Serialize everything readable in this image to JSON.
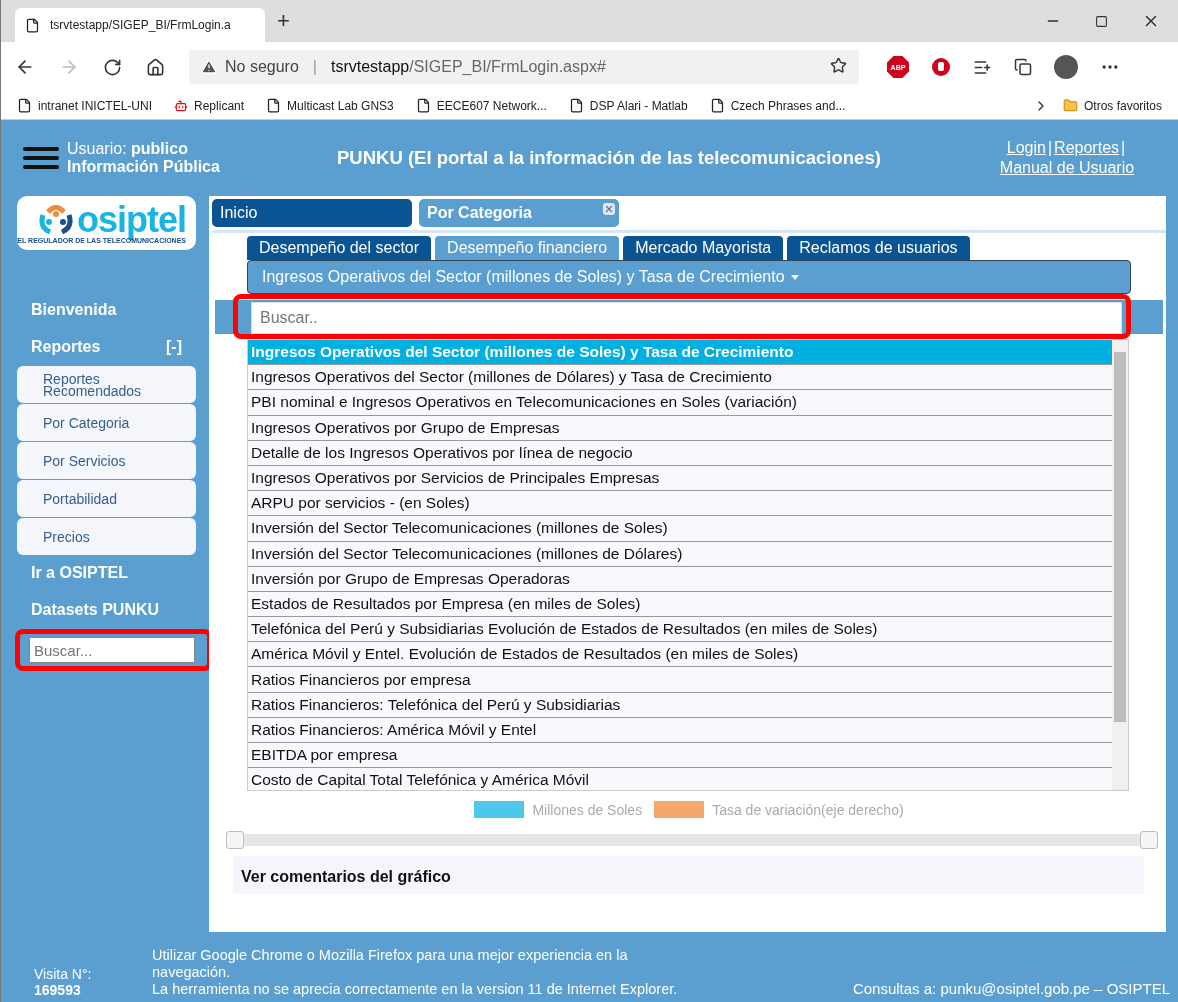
{
  "browser": {
    "tab_title": "tsrvtestapp/SIGEP_BI/FrmLogin.a",
    "new_tab": "+",
    "security": "No seguro",
    "url_separator": "|",
    "url_host": "tsrvtestapp",
    "url_path": "/SIGEP_BI/FrmLogin.aspx#",
    "extension_label": "ABP",
    "bookmarks": [
      {
        "label": "intranet INICTEL-UNI",
        "kind": "page"
      },
      {
        "label": "Replicant",
        "kind": "robot"
      },
      {
        "label": "Multicast Lab   GNS3",
        "kind": "page"
      },
      {
        "label": "EECE607  Network...",
        "kind": "page"
      },
      {
        "label": "DSP Alari - Matlab",
        "kind": "page"
      },
      {
        "label": "Czech Phrases and...",
        "kind": "page"
      }
    ],
    "other_bookmarks": "Otros favoritos"
  },
  "header": {
    "user_label": "Usuario:",
    "user_name": "publico",
    "profile": "Información Pública",
    "title": "PUNKU (El portal a la información de las telecomunicaciones)",
    "links": [
      "Login",
      "Reportes",
      "Manual de Usuario"
    ],
    "separator": "|"
  },
  "sidebar": {
    "logo": "osiptel",
    "tagline": "EL REGULADOR DE LAS TELECOMUNICACIONES",
    "items": [
      {
        "label": "Bienvenida"
      },
      {
        "label": "Reportes",
        "toggle": "[-]",
        "expanded": true,
        "children": [
          {
            "label": "Reportes Recomendados"
          },
          {
            "label": "Por Categoria"
          },
          {
            "label": "Por Servicios"
          },
          {
            "label": "Portabilidad"
          },
          {
            "label": "Precios"
          }
        ]
      },
      {
        "label": "Ir a OSIPTEL"
      },
      {
        "label": "Datasets PUNKU"
      }
    ],
    "search_placeholder": "Buscar..."
  },
  "tabs": [
    {
      "label": "Inicio",
      "selected": false
    },
    {
      "label": "Por Categoria",
      "selected": true,
      "closable": true
    }
  ],
  "subtabs": [
    {
      "label": "Desempeño del sector",
      "selected": false
    },
    {
      "label": "Desempeño financiero",
      "selected": true
    },
    {
      "label": "Mercado Mayorista",
      "selected": false
    },
    {
      "label": "Reclamos de usuarios",
      "selected": false
    }
  ],
  "report_dropdown": {
    "label": "Ingresos Operativos del Sector (millones de Soles) y Tasa de Crecimiento",
    "expanded": true,
    "search_placeholder": "Buscar..",
    "options": [
      {
        "label": "Ingresos Operativos del Sector (millones de Soles) y Tasa de Crecimiento",
        "selected": true
      },
      {
        "label": "Ingresos Operativos del Sector (millones de Dólares) y Tasa de Crecimiento",
        "selected": false
      },
      {
        "label": "PBI nominal e Ingresos Operativos en Telecomunicaciones en Soles (variación)",
        "selected": false
      },
      {
        "label": "Ingresos Operativos por Grupo de Empresas",
        "selected": false
      },
      {
        "label": "Detalle de los Ingresos Operativos por línea de negocio",
        "selected": false
      },
      {
        "label": "Ingresos Operativos por Servicios de Principales Empresas",
        "selected": false
      },
      {
        "label": "ARPU por servicios - (en Soles)",
        "selected": false
      },
      {
        "label": "Inversión del Sector Telecomunicaciones (millones de Soles)",
        "selected": false
      },
      {
        "label": "Inversión del Sector Telecomunicaciones (millones de Dólares)",
        "selected": false
      },
      {
        "label": "Inversión por Grupo de Empresas Operadoras",
        "selected": false
      },
      {
        "label": "Estados de Resultados por Empresa (en miles de Soles)",
        "selected": false
      },
      {
        "label": "Telefónica del Perú y Subsidiarias Evolución de Estados de Resultados (en miles de Soles)",
        "selected": false
      },
      {
        "label": "América Móvil y Entel. Evolución de Estados de Resultados (en miles de Soles)",
        "selected": false
      },
      {
        "label": "Ratios Financieros por empresa",
        "selected": false
      },
      {
        "label": "Ratios Financieros: Telefónica del Perú y Subsidiarias",
        "selected": false
      },
      {
        "label": "Ratios Financieros: América Móvil y Entel",
        "selected": false
      },
      {
        "label": "EBITDA por empresa",
        "selected": false
      },
      {
        "label": "Costo de Capital Total Telefónica y América Móvil",
        "selected": false
      }
    ]
  },
  "legend": [
    {
      "label": "Millones de Soles",
      "color": "#4cc9ea"
    },
    {
      "label": "Tasa de variación(eje derecho)",
      "color": "#f4a96a"
    }
  ],
  "range_slider": {
    "handles": [
      {
        "level": 0
      },
      {
        "level": 1
      }
    ]
  },
  "comments_toggle": "Ver comentarios del gráfico",
  "footer": {
    "visit_label": "Visita N°:",
    "visit_count": "169593",
    "notes": [
      "Utilizar Google Chrome o Mozilla Firefox para una mejor experiencia en la navegación.",
      "La herramienta no se aprecia correctamente en la version 11 de Internet Explorer."
    ],
    "contact": "Consultas a: punku@osiptel.gob.pe – OSIPTEL"
  }
}
